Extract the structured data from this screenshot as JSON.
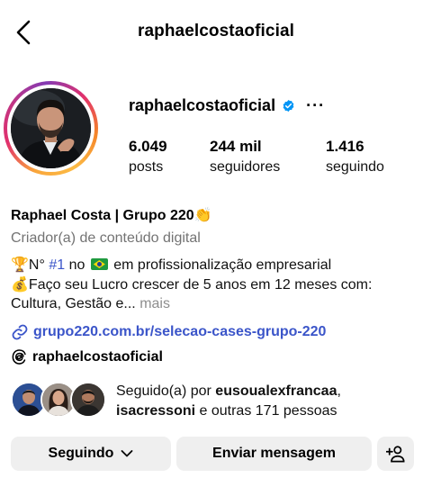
{
  "header": {
    "title": "raphaelcostaoficial"
  },
  "profile": {
    "username": "raphaelcostaoficial",
    "verified": true,
    "stats": {
      "posts": {
        "value": "6.049",
        "label": "posts"
      },
      "followers": {
        "value": "244 mil",
        "label": "seguidores"
      },
      "following": {
        "value": "1.416",
        "label": "seguindo"
      }
    },
    "display_name": "Raphael Costa | Grupo 220👏",
    "category": "Criador(a) de conteúdo digital",
    "bio": {
      "line1_prefix": "🏆N° ",
      "line1_hashtag": "#1",
      "line1_mid": " no ",
      "line1_suffix": " em profissionalização empresarial",
      "line2": "💰Faço seu Lucro crescer de 5 anos em 12 meses com:",
      "line3": "Cultura, Gestão e... ",
      "more_label": "mais"
    },
    "link": "grupo220.com.br/selecao-cases-grupo-220",
    "threads_handle": "raphaelcostaoficial",
    "followed_by": {
      "prefix": "Seguido(a) por ",
      "user1": "eusoualexfrancaa",
      "separator": ",",
      "user2": "isacressoni",
      "suffix": " e outras 171 pessoas"
    }
  },
  "actions": {
    "following_label": "Seguindo",
    "message_label": "Enviar mensagem"
  },
  "icons": {
    "back": "chevron-left-icon",
    "verified": "verified-badge-icon",
    "more": "more-horizontal-icon",
    "link": "link-icon",
    "threads": "threads-icon",
    "dropdown": "chevron-down-icon",
    "add_user": "add-person-icon"
  },
  "colors": {
    "link": "#3b55c9",
    "verified": "#0095f6",
    "muted": "#737373",
    "button_bg": "#efefef"
  }
}
